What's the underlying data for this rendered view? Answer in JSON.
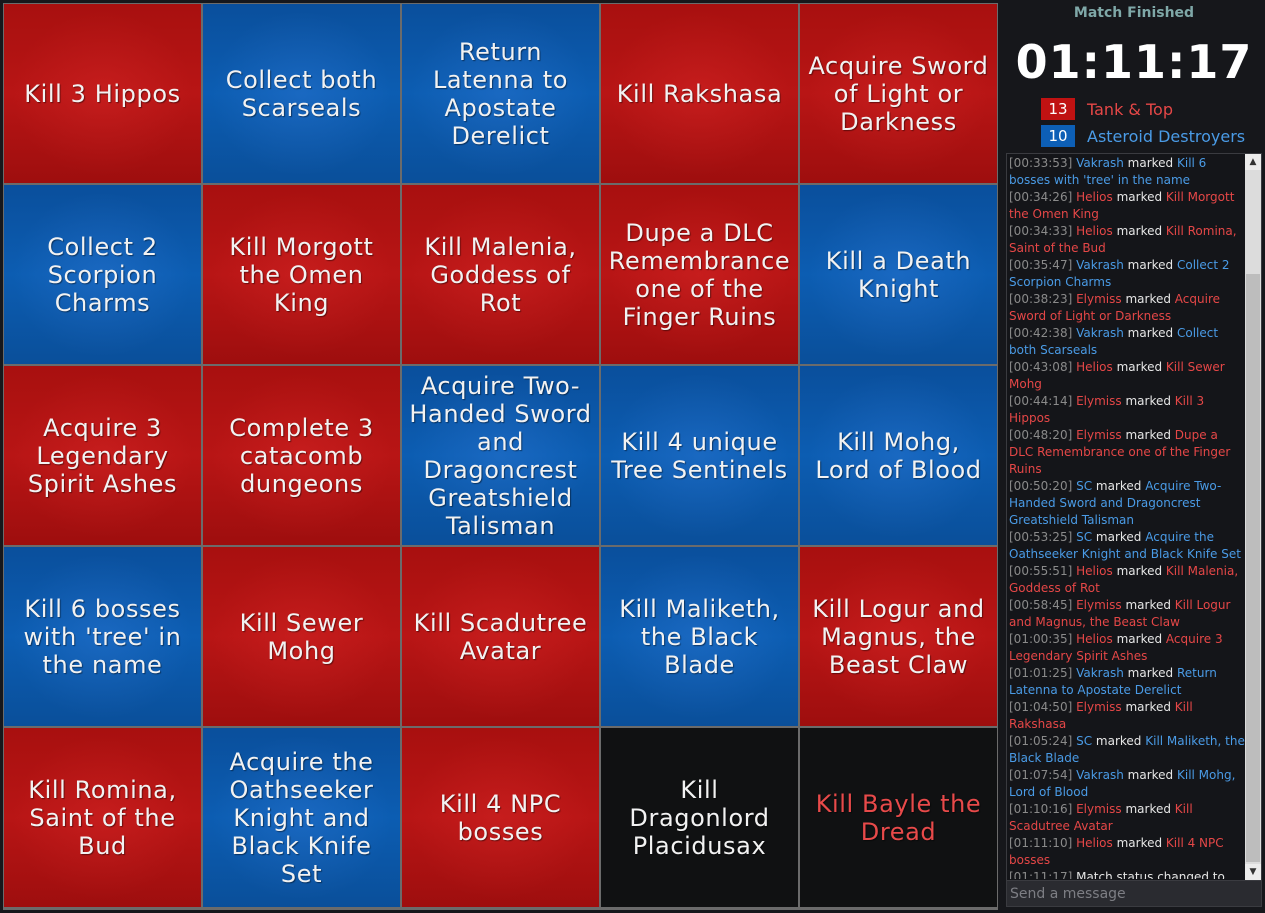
{
  "board": [
    {
      "text": "Kill 3 Hippos",
      "color": "red"
    },
    {
      "text": "Collect both Scarseals",
      "color": "blue"
    },
    {
      "text": "Return Latenna to Apostate Derelict",
      "color": "blue"
    },
    {
      "text": "Kill Rakshasa",
      "color": "red"
    },
    {
      "text": "Acquire Sword of Light or Darkness",
      "color": "red"
    },
    {
      "text": "Collect 2 Scorpion Charms",
      "color": "blue"
    },
    {
      "text": "Kill Morgott the Omen King",
      "color": "red"
    },
    {
      "text": "Kill Malenia, Goddess of Rot",
      "color": "red"
    },
    {
      "text": "Dupe a DLC Remembrance one of the Finger Ruins",
      "color": "red"
    },
    {
      "text": "Kill a Death Knight",
      "color": "blue"
    },
    {
      "text": "Acquire 3 Legendary Spirit Ashes",
      "color": "red"
    },
    {
      "text": "Complete 3 catacomb dungeons",
      "color": "red"
    },
    {
      "text": "Acquire Two-Handed Sword and Dragoncrest Greatshield Talisman",
      "color": "blue"
    },
    {
      "text": "Kill 4 unique Tree Sentinels",
      "color": "blue"
    },
    {
      "text": "Kill Mohg, Lord of Blood",
      "color": "blue"
    },
    {
      "text": "Kill 6 bosses with 'tree' in the name",
      "color": "blue"
    },
    {
      "text": "Kill Sewer Mohg",
      "color": "red"
    },
    {
      "text": "Kill Scadutree Avatar",
      "color": "red"
    },
    {
      "text": "Kill Maliketh, the Black Blade",
      "color": "blue"
    },
    {
      "text": "Kill Logur and Magnus, the Beast Claw",
      "color": "red"
    },
    {
      "text": "Kill Romina, Saint of the Bud",
      "color": "red"
    },
    {
      "text": "Acquire the Oathseeker Knight and Black Knife Set",
      "color": "blue"
    },
    {
      "text": "Kill 4 NPC bosses",
      "color": "red"
    },
    {
      "text": "Kill Dragonlord Placidusax",
      "color": "blank"
    },
    {
      "text": "Kill Bayle the Dread",
      "color": "blank-redtext"
    }
  ],
  "match": {
    "status": "Match Finished",
    "timer": "01:11:17"
  },
  "teams": [
    {
      "score": "13",
      "name": "Tank & Top",
      "color": "#c01212"
    },
    {
      "score": "10",
      "name": "Asteroid Destroyers",
      "color": "#0d5fb6"
    }
  ],
  "chat": {
    "placeholder": "Send a message",
    "messages": [
      {
        "ts": "[00:33:53]",
        "user": "Vakrash",
        "team": "blue",
        "verb": "marked",
        "goal": "Kill 6 bosses with 'tree' in the name"
      },
      {
        "ts": "[00:34:26]",
        "user": "Helios",
        "team": "red",
        "verb": "marked",
        "goal": "Kill Morgott the Omen King"
      },
      {
        "ts": "[00:34:33]",
        "user": "Helios",
        "team": "red",
        "verb": "marked",
        "goal": "Kill Romina, Saint of the Bud"
      },
      {
        "ts": "[00:35:47]",
        "user": "Vakrash",
        "team": "blue",
        "verb": "marked",
        "goal": "Collect 2 Scorpion Charms"
      },
      {
        "ts": "[00:38:23]",
        "user": "Elymiss",
        "team": "red",
        "verb": "marked",
        "goal": "Acquire Sword of Light or Darkness"
      },
      {
        "ts": "[00:42:38]",
        "user": "Vakrash",
        "team": "blue",
        "verb": "marked",
        "goal": "Collect both Scarseals"
      },
      {
        "ts": "[00:43:08]",
        "user": "Helios",
        "team": "red",
        "verb": "marked",
        "goal": "Kill Sewer Mohg"
      },
      {
        "ts": "[00:44:14]",
        "user": "Elymiss",
        "team": "red",
        "verb": "marked",
        "goal": "Kill 3 Hippos"
      },
      {
        "ts": "[00:48:20]",
        "user": "Elymiss",
        "team": "red",
        "verb": "marked",
        "goal": "Dupe a DLC Remembrance one of the Finger Ruins"
      },
      {
        "ts": "[00:50:20]",
        "user": "SC",
        "team": "blue",
        "verb": "marked",
        "goal": "Acquire Two-Handed Sword and Dragoncrest Greatshield Talisman"
      },
      {
        "ts": "[00:53:25]",
        "user": "SC",
        "team": "blue",
        "verb": "marked",
        "goal": "Acquire the Oathseeker Knight and Black Knife Set"
      },
      {
        "ts": "[00:55:51]",
        "user": "Helios",
        "team": "red",
        "verb": "marked",
        "goal": "Kill Malenia, Goddess of Rot"
      },
      {
        "ts": "[00:58:45]",
        "user": "Elymiss",
        "team": "red",
        "verb": "marked",
        "goal": "Kill Logur and Magnus, the Beast Claw"
      },
      {
        "ts": "[01:00:35]",
        "user": "Helios",
        "team": "red",
        "verb": "marked",
        "goal": "Acquire 3 Legendary Spirit Ashes"
      },
      {
        "ts": "[01:01:25]",
        "user": "Vakrash",
        "team": "blue",
        "verb": "marked",
        "goal": "Return Latenna to Apostate Derelict"
      },
      {
        "ts": "[01:04:50]",
        "user": "Elymiss",
        "team": "red",
        "verb": "marked",
        "goal": "Kill Rakshasa"
      },
      {
        "ts": "[01:05:24]",
        "user": "SC",
        "team": "blue",
        "verb": "marked",
        "goal": "Kill Maliketh, the Black Blade"
      },
      {
        "ts": "[01:07:54]",
        "user": "Vakrash",
        "team": "blue",
        "verb": "marked",
        "goal": "Kill Mohg, Lord of Blood"
      },
      {
        "ts": "[01:10:16]",
        "user": "Elymiss",
        "team": "red",
        "verb": "marked",
        "goal": "Kill Scadutree Avatar"
      },
      {
        "ts": "[01:11:10]",
        "user": "Helios",
        "team": "red",
        "verb": "marked",
        "goal": "Kill 4 NPC bosses"
      },
      {
        "ts": "[01:11:17]",
        "user": "",
        "team": "system",
        "verb": "Match status changed to",
        "goal": "Match Finished"
      }
    ]
  },
  "icons": {
    "scroll_up": "arrow-up-icon",
    "scroll_down": "arrow-down-icon"
  }
}
